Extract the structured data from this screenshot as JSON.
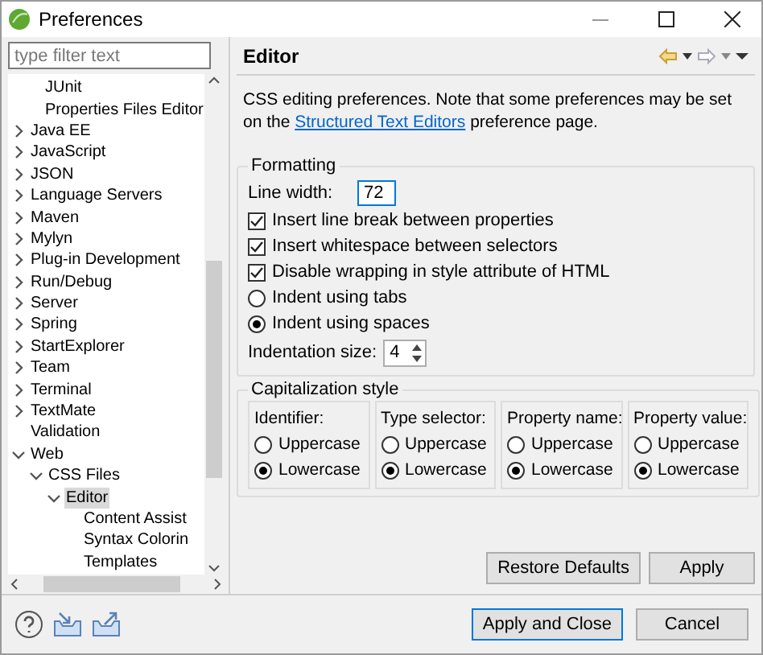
{
  "window": {
    "title": "Preferences"
  },
  "filter": {
    "placeholder": "type filter text"
  },
  "tree": {
    "partial_children": [
      {
        "label": "JUnit"
      },
      {
        "label": "Properties Files Editor"
      }
    ],
    "items": [
      {
        "label": "Java EE",
        "expanded": false
      },
      {
        "label": "JavaScript",
        "expanded": false
      },
      {
        "label": "JSON",
        "expanded": false
      },
      {
        "label": "Language Servers",
        "expanded": false
      },
      {
        "label": "Maven",
        "expanded": false
      },
      {
        "label": "Mylyn",
        "expanded": false
      },
      {
        "label": "Plug-in Development",
        "expanded": false
      },
      {
        "label": "Run/Debug",
        "expanded": false
      },
      {
        "label": "Server",
        "expanded": false
      },
      {
        "label": "Spring",
        "expanded": false
      },
      {
        "label": "StartExplorer",
        "expanded": false
      },
      {
        "label": "Team",
        "expanded": false
      },
      {
        "label": "Terminal",
        "expanded": false
      },
      {
        "label": "TextMate",
        "expanded": false
      },
      {
        "label": "Validation"
      },
      {
        "label": "Web",
        "expanded": true,
        "children": [
          {
            "label": "CSS Files",
            "expanded": true,
            "children": [
              {
                "label": "Editor",
                "expanded": true,
                "selected": true,
                "children": [
                  {
                    "label": "Content Assist",
                    "selected": false
                  },
                  {
                    "label": "Syntax Colorin",
                    "selected": false
                  },
                  {
                    "label": "Templates",
                    "selected": false
                  }
                ]
              }
            ]
          }
        ]
      }
    ]
  },
  "page": {
    "title": "Editor",
    "description": "CSS editing preferences.  Note that some preferences may be set on the",
    "link": "Structured Text Editors",
    "description_end": "preference page.",
    "formatting": {
      "title": "Formatting",
      "line_width": {
        "label": "Line width:",
        "value": "72"
      },
      "options": [
        {
          "kind": "checkbox",
          "label": "Insert line break between properties",
          "checked": true
        },
        {
          "kind": "checkbox",
          "label": "Insert whitespace between selectors",
          "checked": true
        },
        {
          "kind": "checkbox",
          "label": "Disable wrapping in style attribute of HTML",
          "checked": true
        },
        {
          "kind": "radio",
          "label": "Indent using tabs",
          "selected": false
        },
        {
          "kind": "radio",
          "label": "Indent using spaces",
          "selected": true
        }
      ],
      "indentation": {
        "label": "Indentation size:",
        "value": "4"
      }
    },
    "capitalization": {
      "title": "Capitalization style",
      "columns": [
        {
          "label": "Identifier:",
          "options": [
            {
              "label": "Uppercase",
              "selected": false
            },
            {
              "label": "Lowercase",
              "selected": true
            }
          ]
        },
        {
          "label": "Type selector:",
          "options": [
            {
              "label": "Uppercase",
              "selected": false
            },
            {
              "label": "Lowercase",
              "selected": true
            }
          ]
        },
        {
          "label": "Property name:",
          "options": [
            {
              "label": "Uppercase",
              "selected": false
            },
            {
              "label": "Lowercase",
              "selected": true
            }
          ]
        },
        {
          "label": "Property value:",
          "options": [
            {
              "label": "Uppercase",
              "selected": false
            },
            {
              "label": "Lowercase",
              "selected": true
            }
          ]
        }
      ]
    },
    "buttons": [
      "Restore Defaults",
      "Apply"
    ]
  },
  "footer": {
    "buttons": [
      {
        "label": "Apply and Close",
        "default": true
      },
      {
        "label": "Cancel",
        "default": false
      }
    ]
  }
}
